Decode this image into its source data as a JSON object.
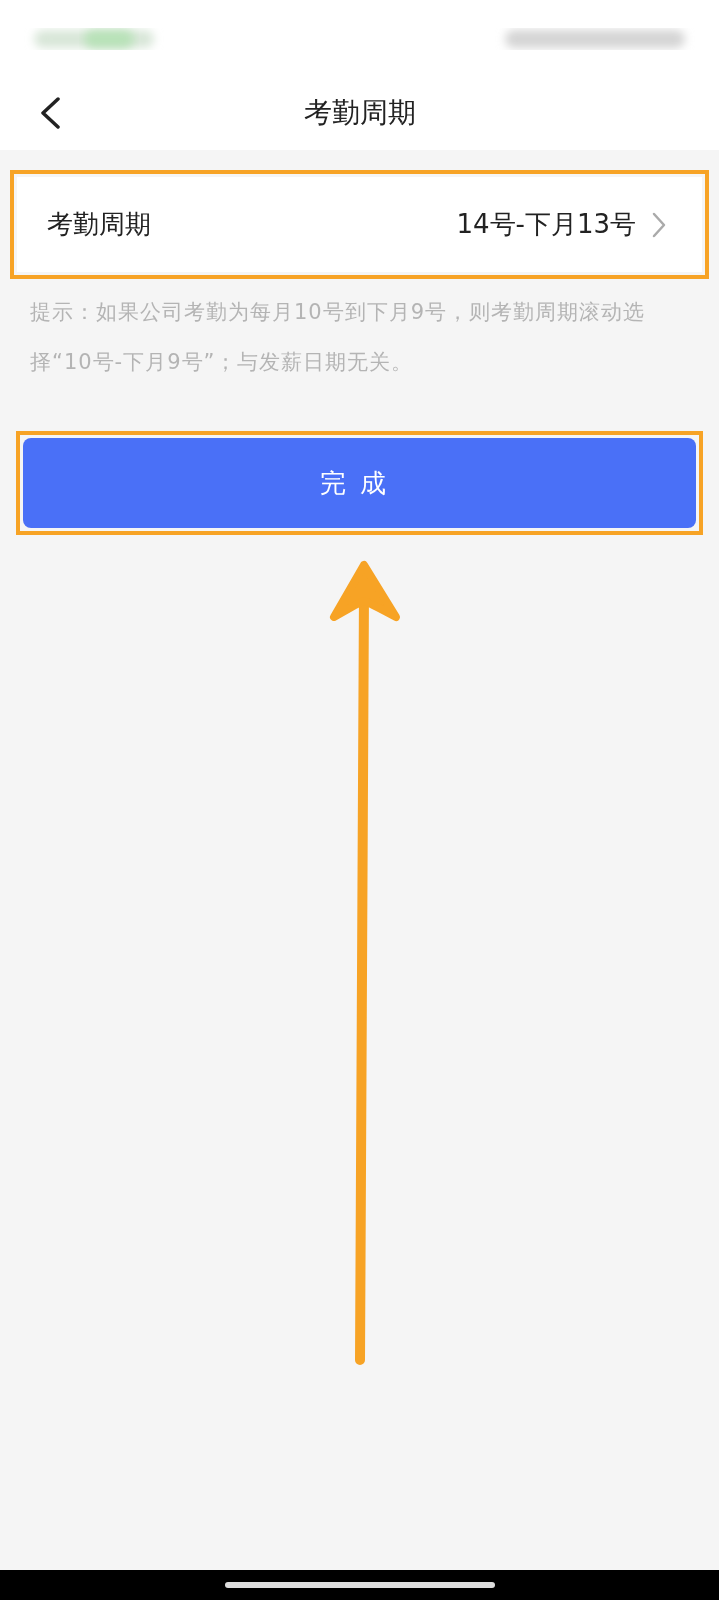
{
  "header": {
    "title": "考勤周期"
  },
  "setting_row": {
    "label": "考勤周期",
    "value": "14号-下月13号",
    "highlighted": true
  },
  "hint": "提示：如果公司考勤为每月10号到下月9号，则考勤周期滚动选择“10号-下月9号”；与发薪日期无关。",
  "button": {
    "label": "完成",
    "highlighted": true
  },
  "annotations": [
    {
      "kind": "arrow"
    }
  ]
}
